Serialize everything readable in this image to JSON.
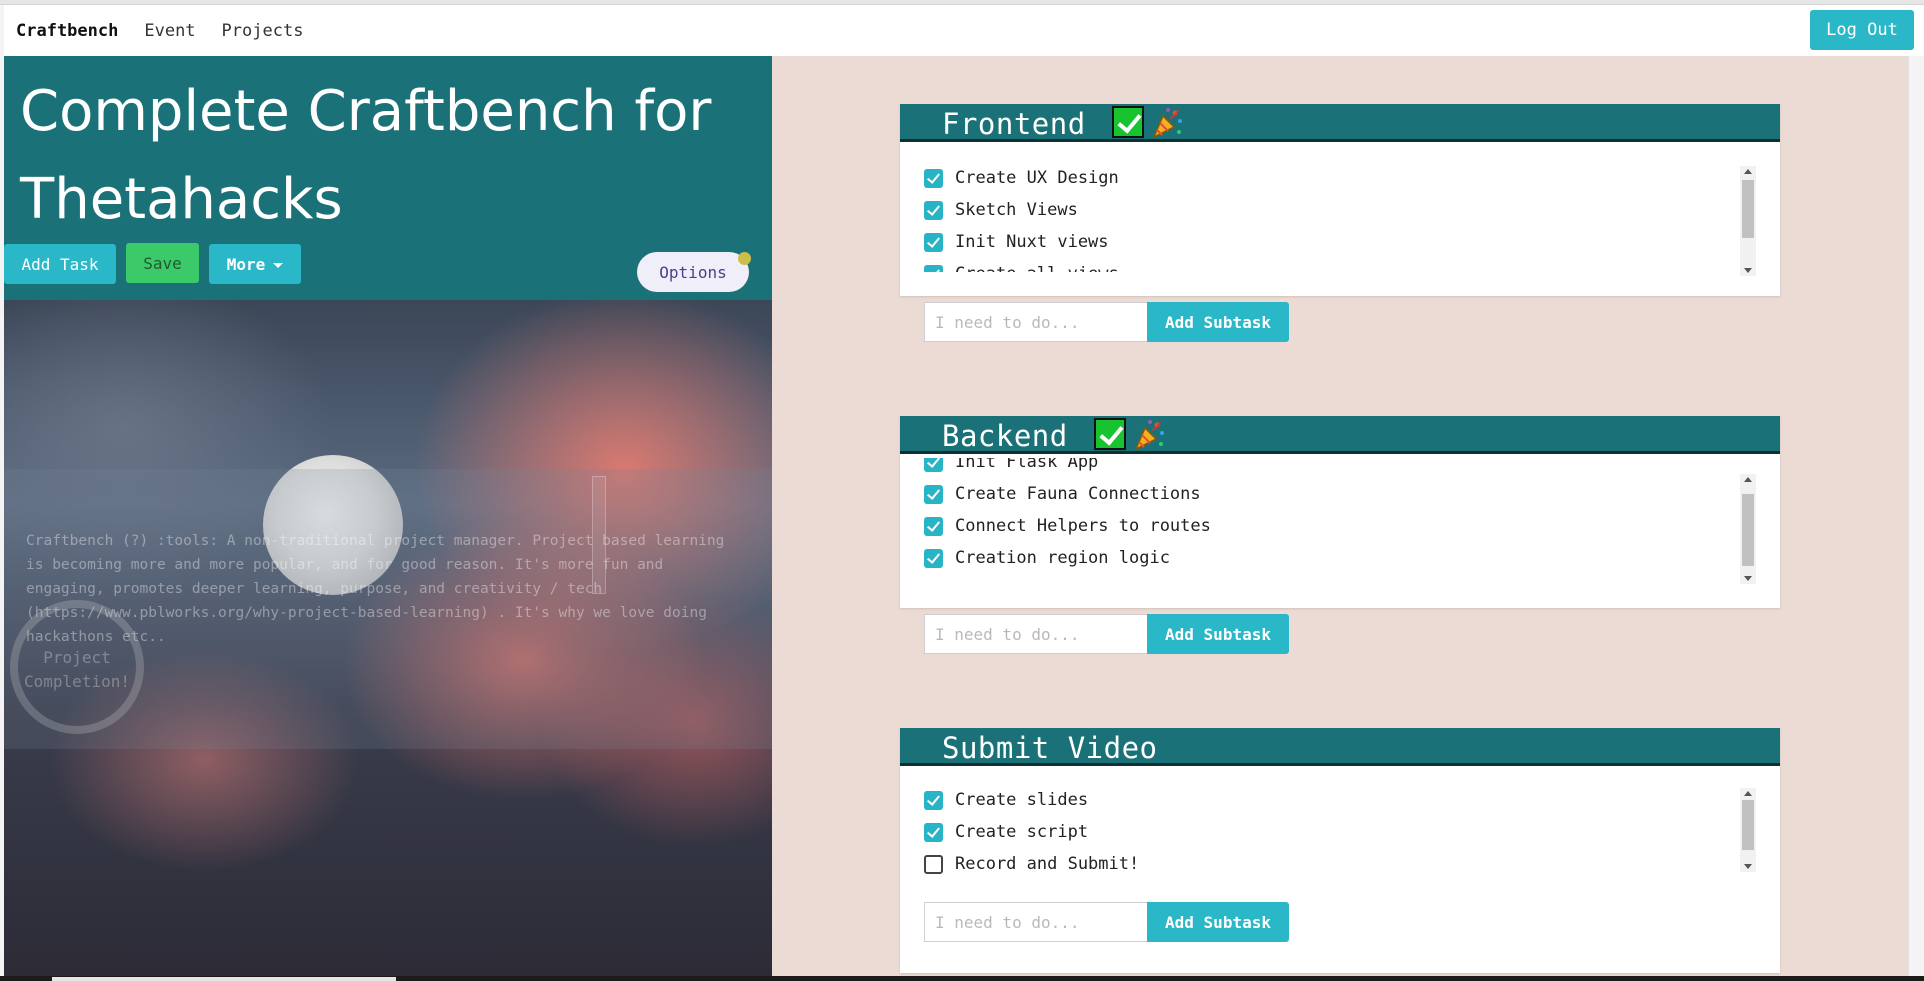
{
  "navbar": {
    "brand": "Craftbench",
    "links": [
      "Event",
      "Projects"
    ],
    "logout_label": "Log Out"
  },
  "project": {
    "title": "Complete Craftbench for Thetahacks",
    "add_task_label": "Add Task",
    "save_label": "Save",
    "more_label": "More",
    "options_label": "Options",
    "description": "Craftbench (?) :tools: A non-traditional project manager. Project based learning is becoming more and more popular, and for good reason. It's more fun and engaging, promotes deeper learning, purpose, and creativity / tech (https://www.pblworks.org/why-project-based-learning) . It's why we love doing hackathons etc..",
    "completion_label": "Project Completion!"
  },
  "tasks": [
    {
      "title": "Frontend",
      "completed": true,
      "subtasks": [
        {
          "label": "Create UX Design",
          "checked": true
        },
        {
          "label": "Sketch Views",
          "checked": true
        },
        {
          "label": "Init Nuxt views",
          "checked": true
        },
        {
          "label": "Create all views",
          "checked": true
        }
      ],
      "input_placeholder": "I need to do...",
      "add_subtask_label": "Add Subtask"
    },
    {
      "title": "Backend",
      "completed": true,
      "subtasks": [
        {
          "label": "Init Flask App",
          "checked": true
        },
        {
          "label": "Create Fauna Connections",
          "checked": true
        },
        {
          "label": "Connect Helpers to routes",
          "checked": true
        },
        {
          "label": "Creation region logic",
          "checked": true
        }
      ],
      "input_placeholder": "I need to do...",
      "add_subtask_label": "Add Subtask"
    },
    {
      "title": "Submit Video",
      "completed": false,
      "subtasks": [
        {
          "label": "Create slides",
          "checked": true
        },
        {
          "label": "Create script",
          "checked": true
        },
        {
          "label": "Record and Submit!",
          "checked": false
        }
      ],
      "input_placeholder": "I need to do...",
      "add_subtask_label": "Add Subtask"
    }
  ],
  "icons": {
    "completed_check": "white-check-mark-icon",
    "completed_party": "party-popper-icon",
    "more_dropdown": "caret-down-icon"
  },
  "colors": {
    "header_teal": "#1a7278",
    "accent_cyan": "#2ab8c9",
    "save_green": "#3cc96a",
    "right_bg": "#ecdbd4"
  }
}
